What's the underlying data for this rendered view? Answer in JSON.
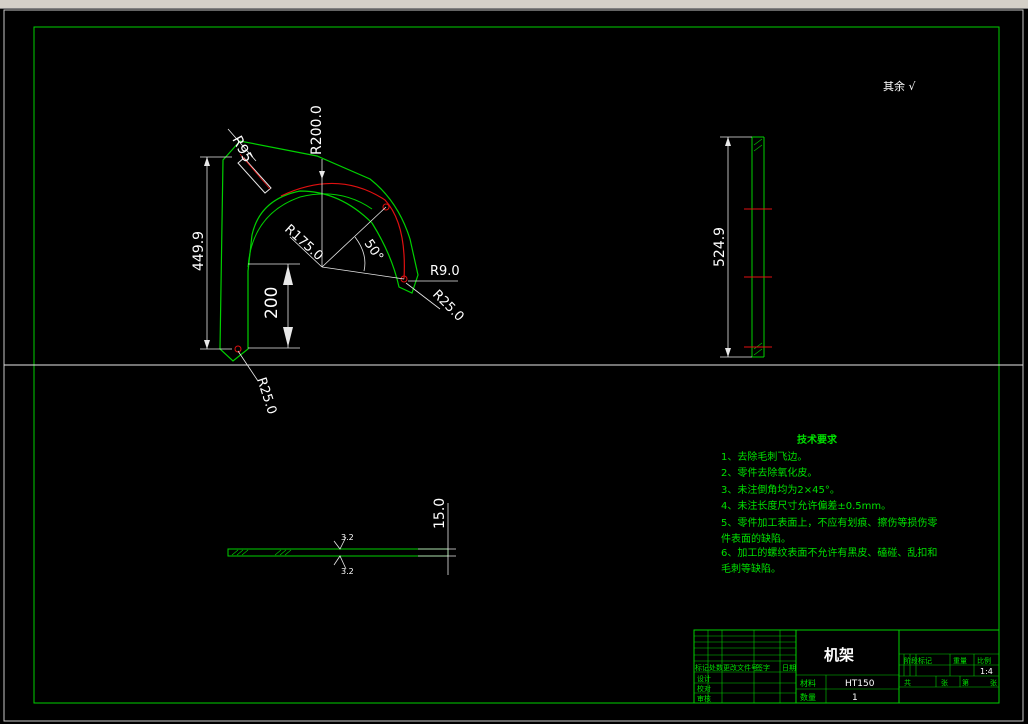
{
  "window": {
    "title": ""
  },
  "drawing": {
    "rough_note": "其余 √",
    "dims": {
      "r95": "R95",
      "r200": "R200.0",
      "r175": "R175.0",
      "angle": "50°",
      "r9": "R9.0",
      "r25_right": "R25.0",
      "r25_bottom": "R25.0",
      "h449": "449.9",
      "h200": "200",
      "side_length": "524.9",
      "thickness": "15.0",
      "rough_top": "3.2",
      "rough_bottom": "3.2"
    },
    "tech_requirements": {
      "title": "技术要求",
      "items": [
        "1、去除毛刺飞边。",
        "2、零件去除氧化皮。",
        "3、未注倒角均为2×45°。",
        "4、未注长度尺寸允许偏差±0.5mm。",
        "5、零件加工表面上，不应有划痕、擦伤等损伤零",
        "件表面的缺陷。",
        "6、加工的螺纹表面不允许有黑皮、磕碰、乱扣和",
        "毛刺等缺陷。"
      ]
    },
    "title_block": {
      "part_name": "机架",
      "material_label": "材料",
      "material": "HT150",
      "quantity_label": "数量",
      "quantity": "1",
      "scale": "1:4",
      "stage_mark_label": "阶段标记",
      "weight_label": "重量",
      "scale_label": "比例",
      "mark_label": "标记",
      "count_label": "处数",
      "file_no_label": "更改文件号",
      "sign_label": "签字",
      "date_label": "日期",
      "design_label": "设计",
      "check_label": "校对",
      "review_label": "审核",
      "total_label": "共",
      "sheet_label": "张",
      "page_label": "第",
      "page_unit": "张"
    }
  }
}
